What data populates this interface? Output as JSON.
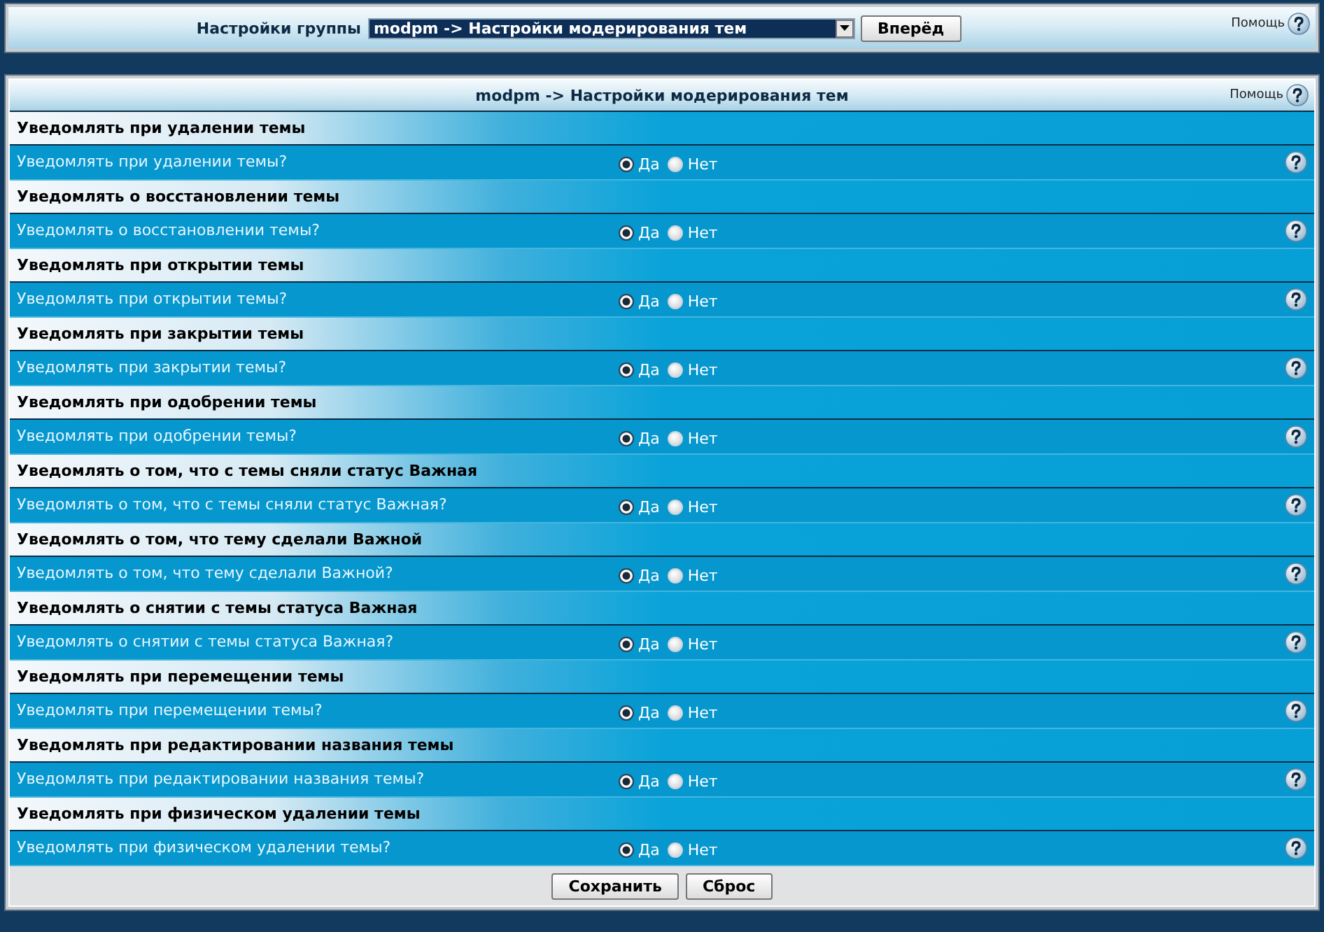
{
  "group_bar": {
    "label": "Настройки группы",
    "select_value": "modpm -> Настройки модерирования тем",
    "go_button": "Вперёд",
    "help": "Помощь"
  },
  "panel": {
    "title": "modpm -> Настройки модерирования тем",
    "help": "Помощь",
    "settings": [
      {
        "title": "Уведомлять при удалении темы",
        "question": "Уведомлять при удалении темы?",
        "options": [
          {
            "label": "Да",
            "selected": true
          },
          {
            "label": "Нет",
            "selected": false
          }
        ]
      },
      {
        "title": "Уведомлять о восстановлении темы",
        "question": "Уведомлять о восстановлении темы?",
        "options": [
          {
            "label": "Да",
            "selected": true
          },
          {
            "label": "Нет",
            "selected": false
          }
        ]
      },
      {
        "title": "Уведомлять при открытии темы",
        "question": "Уведомлять при открытии темы?",
        "options": [
          {
            "label": "Да",
            "selected": true
          },
          {
            "label": "Нет",
            "selected": false
          }
        ]
      },
      {
        "title": "Уведомлять при закрытии темы",
        "question": "Уведомлять при закрытии темы?",
        "options": [
          {
            "label": "Да",
            "selected": true
          },
          {
            "label": "Нет",
            "selected": false
          }
        ]
      },
      {
        "title": "Уведомлять при одобрении темы",
        "question": "Уведомлять при одобрении темы?",
        "options": [
          {
            "label": "Да",
            "selected": true
          },
          {
            "label": "Нет",
            "selected": false
          }
        ]
      },
      {
        "title": "Уведомлять о том, что с темы сняли статус Важная",
        "question": "Уведомлять о том, что с темы сняли статус Важная?",
        "options": [
          {
            "label": "Да",
            "selected": true
          },
          {
            "label": "Нет",
            "selected": false
          }
        ]
      },
      {
        "title": "Уведомлять о том, что тему сделали Важной",
        "question": "Уведомлять о том, что тему сделали Важной?",
        "options": [
          {
            "label": "Да",
            "selected": true
          },
          {
            "label": "Нет",
            "selected": false
          }
        ]
      },
      {
        "title": "Уведомлять о снятии с темы статуса Важная",
        "question": "Уведомлять о снятии с темы статуса Важная?",
        "options": [
          {
            "label": "Да",
            "selected": true
          },
          {
            "label": "Нет",
            "selected": false
          }
        ]
      },
      {
        "title": "Уведомлять при перемещении темы",
        "question": "Уведомлять при перемещении темы?",
        "options": [
          {
            "label": "Да",
            "selected": true
          },
          {
            "label": "Нет",
            "selected": false
          }
        ]
      },
      {
        "title": "Уведомлять при редактировании названия темы",
        "question": "Уведомлять при редактировании названия темы?",
        "options": [
          {
            "label": "Да",
            "selected": true
          },
          {
            "label": "Нет",
            "selected": false
          }
        ]
      },
      {
        "title": "Уведомлять при физическом удалении темы",
        "question": "Уведомлять при физическом удалении темы?",
        "options": [
          {
            "label": "Да",
            "selected": true
          },
          {
            "label": "Нет",
            "selected": false
          }
        ]
      }
    ],
    "buttons": [
      "Сохранить",
      "Сброс"
    ]
  }
}
